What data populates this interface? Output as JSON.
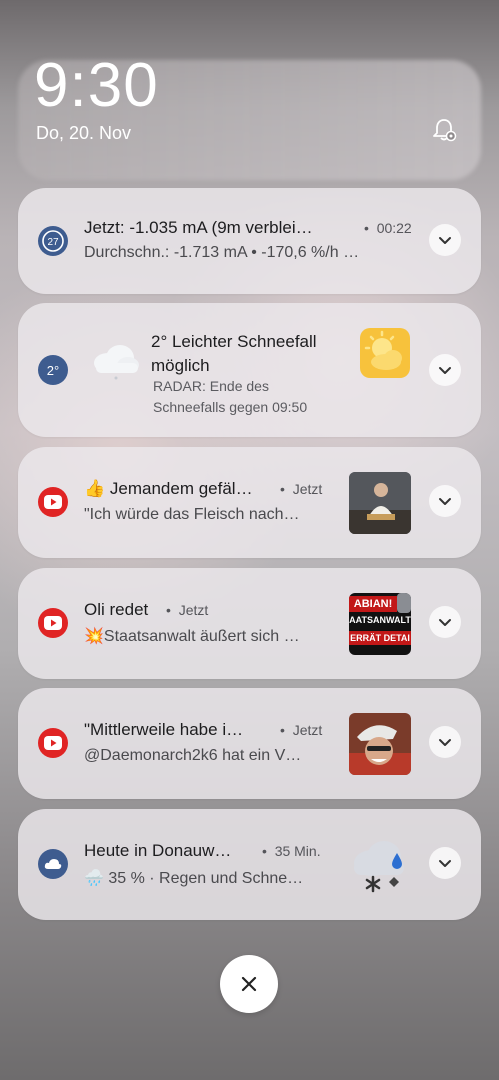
{
  "lockscreen": {
    "time": "9:30",
    "date": "Do, 20. Nov"
  },
  "notifications": [
    {
      "app_icon": "battery-cycle-icon",
      "title": "Jetzt: -1.035 mA (9m verblei…",
      "time": "00:22",
      "subtitle": "Durchschn.: -1.713 mA  •  -170,6 %/h …",
      "badge": "27"
    },
    {
      "app_icon": "weather-temp-icon",
      "badge": "2°",
      "title_line1": "2° Leichter Schneefall",
      "title_line2": "möglich",
      "subtitle_line1": "RADAR: Ende des",
      "subtitle_line2": "Schneefalls gegen 09:50"
    },
    {
      "app_icon": "youtube-icon",
      "title": "👍 Jemandem gefäl…",
      "time": "Jetzt",
      "subtitle": "\"Ich würde das Fleisch nach…"
    },
    {
      "app_icon": "youtube-icon",
      "title": "Oli redet",
      "time": "Jetzt",
      "subtitle": "💥Staatsanwalt äußert sich …",
      "thumb_text_1": "ABIAN!",
      "thumb_text_2": "AATSANWALT",
      "thumb_text_3": "ERRÄT DETAI"
    },
    {
      "app_icon": "youtube-icon",
      "title": "\"Mittlerweile habe i…",
      "time": "Jetzt",
      "subtitle": "@Daemonarch2k6 hat ein V…"
    },
    {
      "app_icon": "cloud-icon",
      "title": "Heute in Donauw…",
      "time": "35 Min.",
      "subtitle": "🌧️ 35 % · Regen und Schne…"
    }
  ],
  "colors": {
    "youtube_red": "#e02424",
    "weather_blue": "#3e5c8f",
    "sun_yellow": "#f7c23c"
  }
}
